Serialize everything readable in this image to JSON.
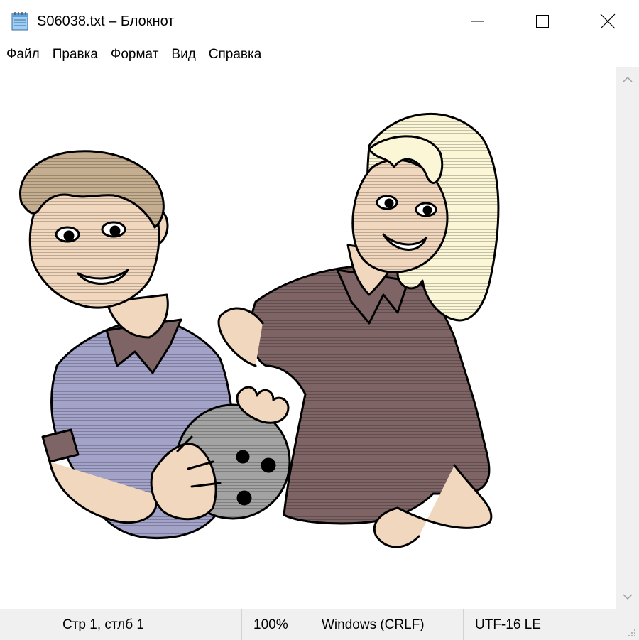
{
  "window": {
    "title": "S06038.txt – Блокнот",
    "icon": "notepad-icon"
  },
  "menu": {
    "items": [
      {
        "label": "Файл"
      },
      {
        "label": "Правка"
      },
      {
        "label": "Формат"
      },
      {
        "label": "Вид"
      },
      {
        "label": "Справка"
      }
    ]
  },
  "editor": {
    "content_image": "cartoon-couple-with-bowling-ball"
  },
  "statusbar": {
    "position": "Стр 1, стлб 1",
    "zoom": "100%",
    "line_endings": "Windows (CRLF)",
    "encoding": "UTF-16 LE"
  },
  "colors": {
    "titlebar_bg": "#ffffff",
    "statusbar_bg": "#f0f0f0",
    "scrollbar_bg": "#f0f0f0",
    "man_shirt": "#a3a2c8",
    "woman_shirt": "#7e6465",
    "skin": "#f1d7bd",
    "woman_hair": "#fbf6d6",
    "man_hair": "#c5ad8f",
    "ball": "#a3a3a3"
  }
}
